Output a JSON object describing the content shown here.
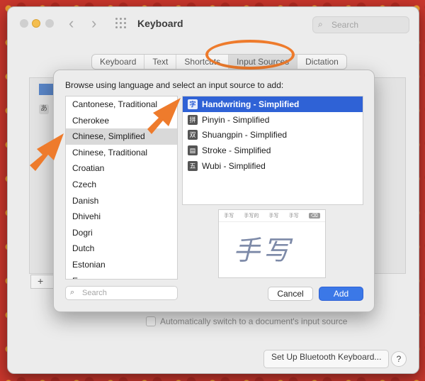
{
  "window": {
    "title": "Keyboard",
    "search_placeholder": "Search"
  },
  "tabs": [
    {
      "label": "Keyboard"
    },
    {
      "label": "Text"
    },
    {
      "label": "Shortcuts"
    },
    {
      "label": "Input Sources",
      "selected": true
    },
    {
      "label": "Dictation"
    }
  ],
  "background_panel": {
    "auto_switch_label": "Automatically switch to a document's input source",
    "bluetooth_button": "Set Up Bluetooth Keyboard...",
    "help_label": "?",
    "add_remove_label": "+",
    "ja_label": "あ"
  },
  "dialog": {
    "prompt": "Browse using language and select an input source to add:",
    "languages": [
      {
        "label": "Cantonese, Traditional"
      },
      {
        "label": "Cherokee"
      },
      {
        "label": "Chinese, Simplified",
        "selected": true
      },
      {
        "label": "Chinese, Traditional"
      },
      {
        "label": "Croatian"
      },
      {
        "label": "Czech"
      },
      {
        "label": "Danish"
      },
      {
        "label": "Dhivehi"
      },
      {
        "label": "Dogri"
      },
      {
        "label": "Dutch"
      },
      {
        "label": "Estonian"
      },
      {
        "label": "E..."
      }
    ],
    "sources": [
      {
        "icon": "字",
        "label": "Handwriting - Simplified",
        "selected": true
      },
      {
        "icon": "拼",
        "label": "Pinyin - Simplified"
      },
      {
        "icon": "双",
        "label": "Shuangpin - Simplified"
      },
      {
        "icon": "▤",
        "label": "Stroke - Simplified"
      },
      {
        "icon": "五",
        "label": "Wubi - Simplified"
      }
    ],
    "preview": {
      "candidates": [
        "手写",
        "手写的",
        "手写",
        "手写"
      ],
      "delete_key": "⌫",
      "handwriting": "手写"
    },
    "search_placeholder": "Search",
    "cancel_label": "Cancel",
    "add_label": "Add"
  },
  "colors": {
    "accent": "#2f62d6",
    "annotation": "#ee7b2c",
    "add_button": "#3b78e7"
  }
}
